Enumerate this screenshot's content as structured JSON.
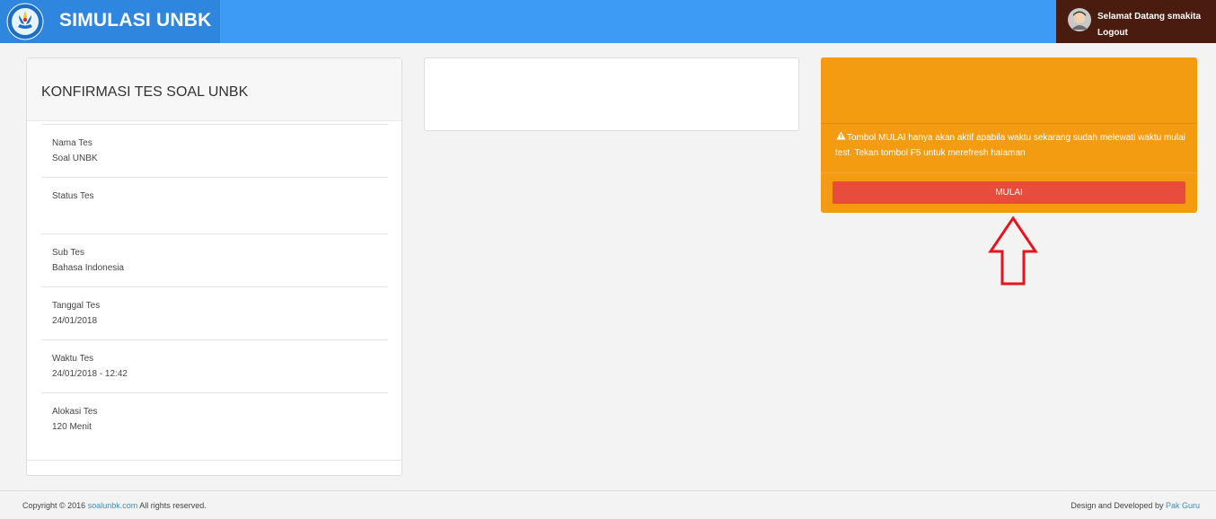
{
  "header": {
    "title": "SIMULASI UNBK",
    "welcome": "Selamat Datang smakita",
    "logout": "Logout",
    "colors": {
      "bar": "#3d9bf6",
      "brand": "#2f86de",
      "user_box": "#4a1c10"
    }
  },
  "confirm_card": {
    "title": "KONFIRMASI TES SOAL UNBK",
    "rows": [
      {
        "label": "Nama Tes",
        "value": "Soal UNBK"
      },
      {
        "label": "Status Tes",
        "value": ""
      },
      {
        "label": "Sub Tes",
        "value": "Bahasa Indonesia"
      },
      {
        "label": "Tanggal Tes",
        "value": "24/01/2018"
      },
      {
        "label": "Waktu Tes",
        "value": "24/01/2018 - 12:42"
      },
      {
        "label": "Alokasi Tes",
        "value": "120 Menit"
      }
    ]
  },
  "action_card": {
    "warning": "Tombol MULAI hanya akan aktif apabila waktu sekarang sudah melewati waktu mulai test. Tekan tombol F5 untuk merefresh halaman",
    "warning_icon": "warning-icon",
    "button": "MULAI",
    "colors": {
      "card": "#f39c12",
      "button": "#e74c3c"
    }
  },
  "annotation": {
    "arrow_icon": "arrow-up-outline-icon",
    "color": "#e8141c"
  },
  "footer": {
    "copyright_prefix": "Copyright © 2016",
    "copyright_link": "soalunbk.com",
    "copyright_suffix": "All rights reserved.",
    "credit_prefix": "Design and Developed by",
    "credit_link": "Pak Guru"
  }
}
